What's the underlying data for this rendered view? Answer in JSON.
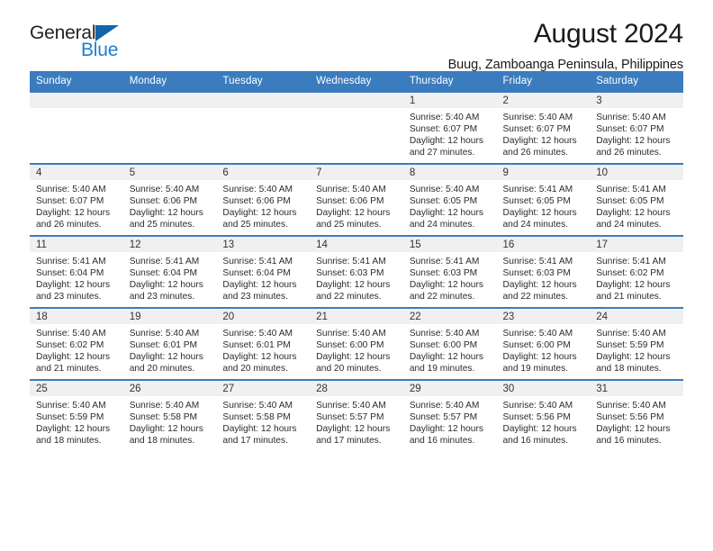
{
  "brand": {
    "name_part1": "General",
    "name_part2": "Blue",
    "triangle_color": "#1464aa",
    "blue_text_color": "#1b7fd4"
  },
  "header": {
    "title": "August 2024",
    "subtitle": "Buug, Zamboanga Peninsula, Philippines"
  },
  "theme": {
    "header_blue": "#3a7cbe",
    "daynum_band": "#f0f0f0",
    "text": "#2b2b2b"
  },
  "weekday_headers": [
    "Sunday",
    "Monday",
    "Tuesday",
    "Wednesday",
    "Thursday",
    "Friday",
    "Saturday"
  ],
  "weeks": [
    [
      {
        "day": "",
        "sunrise": "",
        "sunset": "",
        "daylight_line1": "",
        "daylight_line2": "",
        "empty": true
      },
      {
        "day": "",
        "sunrise": "",
        "sunset": "",
        "daylight_line1": "",
        "daylight_line2": "",
        "empty": true
      },
      {
        "day": "",
        "sunrise": "",
        "sunset": "",
        "daylight_line1": "",
        "daylight_line2": "",
        "empty": true
      },
      {
        "day": "",
        "sunrise": "",
        "sunset": "",
        "daylight_line1": "",
        "daylight_line2": "",
        "empty": true
      },
      {
        "day": "1",
        "sunrise": "Sunrise: 5:40 AM",
        "sunset": "Sunset: 6:07 PM",
        "daylight_line1": "Daylight: 12 hours",
        "daylight_line2": "and 27 minutes."
      },
      {
        "day": "2",
        "sunrise": "Sunrise: 5:40 AM",
        "sunset": "Sunset: 6:07 PM",
        "daylight_line1": "Daylight: 12 hours",
        "daylight_line2": "and 26 minutes."
      },
      {
        "day": "3",
        "sunrise": "Sunrise: 5:40 AM",
        "sunset": "Sunset: 6:07 PM",
        "daylight_line1": "Daylight: 12 hours",
        "daylight_line2": "and 26 minutes."
      }
    ],
    [
      {
        "day": "4",
        "sunrise": "Sunrise: 5:40 AM",
        "sunset": "Sunset: 6:07 PM",
        "daylight_line1": "Daylight: 12 hours",
        "daylight_line2": "and 26 minutes."
      },
      {
        "day": "5",
        "sunrise": "Sunrise: 5:40 AM",
        "sunset": "Sunset: 6:06 PM",
        "daylight_line1": "Daylight: 12 hours",
        "daylight_line2": "and 25 minutes."
      },
      {
        "day": "6",
        "sunrise": "Sunrise: 5:40 AM",
        "sunset": "Sunset: 6:06 PM",
        "daylight_line1": "Daylight: 12 hours",
        "daylight_line2": "and 25 minutes."
      },
      {
        "day": "7",
        "sunrise": "Sunrise: 5:40 AM",
        "sunset": "Sunset: 6:06 PM",
        "daylight_line1": "Daylight: 12 hours",
        "daylight_line2": "and 25 minutes."
      },
      {
        "day": "8",
        "sunrise": "Sunrise: 5:40 AM",
        "sunset": "Sunset: 6:05 PM",
        "daylight_line1": "Daylight: 12 hours",
        "daylight_line2": "and 24 minutes."
      },
      {
        "day": "9",
        "sunrise": "Sunrise: 5:41 AM",
        "sunset": "Sunset: 6:05 PM",
        "daylight_line1": "Daylight: 12 hours",
        "daylight_line2": "and 24 minutes."
      },
      {
        "day": "10",
        "sunrise": "Sunrise: 5:41 AM",
        "sunset": "Sunset: 6:05 PM",
        "daylight_line1": "Daylight: 12 hours",
        "daylight_line2": "and 24 minutes."
      }
    ],
    [
      {
        "day": "11",
        "sunrise": "Sunrise: 5:41 AM",
        "sunset": "Sunset: 6:04 PM",
        "daylight_line1": "Daylight: 12 hours",
        "daylight_line2": "and 23 minutes."
      },
      {
        "day": "12",
        "sunrise": "Sunrise: 5:41 AM",
        "sunset": "Sunset: 6:04 PM",
        "daylight_line1": "Daylight: 12 hours",
        "daylight_line2": "and 23 minutes."
      },
      {
        "day": "13",
        "sunrise": "Sunrise: 5:41 AM",
        "sunset": "Sunset: 6:04 PM",
        "daylight_line1": "Daylight: 12 hours",
        "daylight_line2": "and 23 minutes."
      },
      {
        "day": "14",
        "sunrise": "Sunrise: 5:41 AM",
        "sunset": "Sunset: 6:03 PM",
        "daylight_line1": "Daylight: 12 hours",
        "daylight_line2": "and 22 minutes."
      },
      {
        "day": "15",
        "sunrise": "Sunrise: 5:41 AM",
        "sunset": "Sunset: 6:03 PM",
        "daylight_line1": "Daylight: 12 hours",
        "daylight_line2": "and 22 minutes."
      },
      {
        "day": "16",
        "sunrise": "Sunrise: 5:41 AM",
        "sunset": "Sunset: 6:03 PM",
        "daylight_line1": "Daylight: 12 hours",
        "daylight_line2": "and 22 minutes."
      },
      {
        "day": "17",
        "sunrise": "Sunrise: 5:41 AM",
        "sunset": "Sunset: 6:02 PM",
        "daylight_line1": "Daylight: 12 hours",
        "daylight_line2": "and 21 minutes."
      }
    ],
    [
      {
        "day": "18",
        "sunrise": "Sunrise: 5:40 AM",
        "sunset": "Sunset: 6:02 PM",
        "daylight_line1": "Daylight: 12 hours",
        "daylight_line2": "and 21 minutes."
      },
      {
        "day": "19",
        "sunrise": "Sunrise: 5:40 AM",
        "sunset": "Sunset: 6:01 PM",
        "daylight_line1": "Daylight: 12 hours",
        "daylight_line2": "and 20 minutes."
      },
      {
        "day": "20",
        "sunrise": "Sunrise: 5:40 AM",
        "sunset": "Sunset: 6:01 PM",
        "daylight_line1": "Daylight: 12 hours",
        "daylight_line2": "and 20 minutes."
      },
      {
        "day": "21",
        "sunrise": "Sunrise: 5:40 AM",
        "sunset": "Sunset: 6:00 PM",
        "daylight_line1": "Daylight: 12 hours",
        "daylight_line2": "and 20 minutes."
      },
      {
        "day": "22",
        "sunrise": "Sunrise: 5:40 AM",
        "sunset": "Sunset: 6:00 PM",
        "daylight_line1": "Daylight: 12 hours",
        "daylight_line2": "and 19 minutes."
      },
      {
        "day": "23",
        "sunrise": "Sunrise: 5:40 AM",
        "sunset": "Sunset: 6:00 PM",
        "daylight_line1": "Daylight: 12 hours",
        "daylight_line2": "and 19 minutes."
      },
      {
        "day": "24",
        "sunrise": "Sunrise: 5:40 AM",
        "sunset": "Sunset: 5:59 PM",
        "daylight_line1": "Daylight: 12 hours",
        "daylight_line2": "and 18 minutes."
      }
    ],
    [
      {
        "day": "25",
        "sunrise": "Sunrise: 5:40 AM",
        "sunset": "Sunset: 5:59 PM",
        "daylight_line1": "Daylight: 12 hours",
        "daylight_line2": "and 18 minutes."
      },
      {
        "day": "26",
        "sunrise": "Sunrise: 5:40 AM",
        "sunset": "Sunset: 5:58 PM",
        "daylight_line1": "Daylight: 12 hours",
        "daylight_line2": "and 18 minutes."
      },
      {
        "day": "27",
        "sunrise": "Sunrise: 5:40 AM",
        "sunset": "Sunset: 5:58 PM",
        "daylight_line1": "Daylight: 12 hours",
        "daylight_line2": "and 17 minutes."
      },
      {
        "day": "28",
        "sunrise": "Sunrise: 5:40 AM",
        "sunset": "Sunset: 5:57 PM",
        "daylight_line1": "Daylight: 12 hours",
        "daylight_line2": "and 17 minutes."
      },
      {
        "day": "29",
        "sunrise": "Sunrise: 5:40 AM",
        "sunset": "Sunset: 5:57 PM",
        "daylight_line1": "Daylight: 12 hours",
        "daylight_line2": "and 16 minutes."
      },
      {
        "day": "30",
        "sunrise": "Sunrise: 5:40 AM",
        "sunset": "Sunset: 5:56 PM",
        "daylight_line1": "Daylight: 12 hours",
        "daylight_line2": "and 16 minutes."
      },
      {
        "day": "31",
        "sunrise": "Sunrise: 5:40 AM",
        "sunset": "Sunset: 5:56 PM",
        "daylight_line1": "Daylight: 12 hours",
        "daylight_line2": "and 16 minutes."
      }
    ]
  ]
}
